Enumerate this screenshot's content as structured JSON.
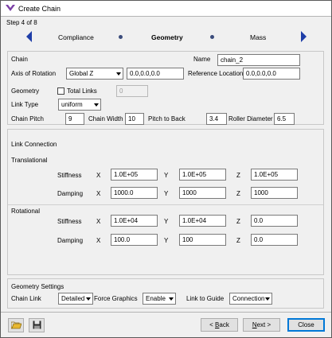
{
  "window": {
    "title": "Create Chain"
  },
  "wizard": {
    "step_text": "Step 4 of 8",
    "tabs": [
      "Compliance",
      "Geometry",
      "Mass"
    ]
  },
  "chain": {
    "section_label": "Chain",
    "axis_label": "Axis of Rotation",
    "axis_value": "Global Z",
    "axis_vector": "0.0,0.0,0.0",
    "name_label": "Name",
    "name_value": "chain_2",
    "ref_label": "Reference Location",
    "ref_value": "0.0,0.0,0.0"
  },
  "geometry": {
    "label": "Geometry",
    "total_links_label": "Total Links",
    "total_links_value": "0",
    "link_type_label": "Link Type",
    "link_type_value": "uniform",
    "pitch_label": "Chain Pitch",
    "pitch_value": "9",
    "width_label": "Chain Width",
    "width_value": "10",
    "pitch_back_label": "Pitch to Back",
    "pitch_back_value": "3.4",
    "roller_label": "Roller Diameter",
    "roller_value": "6.5"
  },
  "link_connection": {
    "label": "Link Connection",
    "translational": {
      "label": "Translational",
      "stiffness_label": "Stiffness",
      "stiffness": [
        "1.0E+05",
        "1.0E+05",
        "1.0E+05"
      ],
      "damping_label": "Damping",
      "damping": [
        "1000.0",
        "1000",
        "1000"
      ]
    },
    "rotational": {
      "label": "Rotational",
      "stiffness_label": "Stiffness",
      "stiffness": [
        "1.0E+04",
        "1.0E+04",
        "0.0"
      ],
      "damping_label": "Damping",
      "damping": [
        "100.0",
        "100",
        "0.0"
      ]
    },
    "axes": [
      "X",
      "Y",
      "Z"
    ]
  },
  "geometry_settings": {
    "label": "Geometry Settings",
    "chain_link_label": "Chain Link",
    "chain_link_value": "Detailed",
    "force_graphics_label": "Force Graphics",
    "force_graphics_value": "Enable",
    "link_guide_label": "Link to Guide",
    "link_guide_value": "Connection"
  },
  "footer": {
    "back_prefix": "< ",
    "back_key": "B",
    "back_rest": "ack",
    "next_key": "N",
    "next_rest": "ext >",
    "close_label": "Close"
  },
  "colors": {
    "accent": "#1f3ea8",
    "tab_dot": "#3b4c7c"
  }
}
